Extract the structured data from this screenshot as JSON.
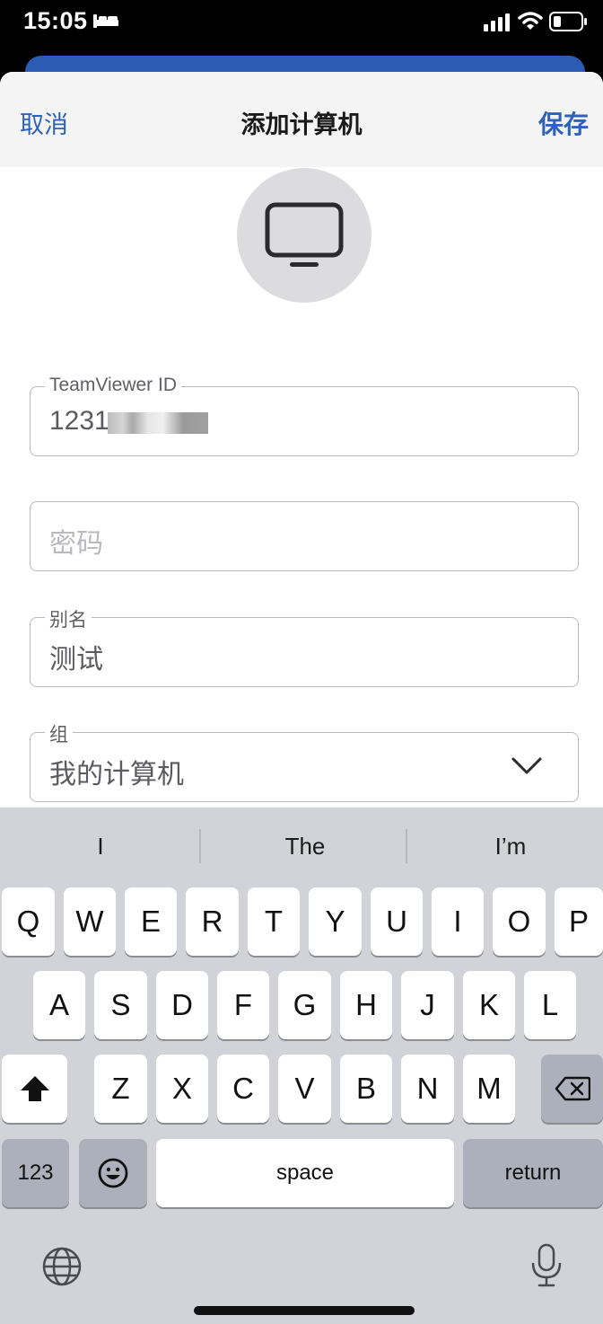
{
  "status_bar": {
    "time": "15:05"
  },
  "nav": {
    "cancel_label": "取消",
    "title": "添加计算机",
    "save_label": "保存"
  },
  "form": {
    "teamviewer_id": {
      "label": "TeamViewer ID",
      "value": "1231"
    },
    "password": {
      "placeholder": "密码"
    },
    "alias": {
      "label": "别名",
      "value": "测试"
    },
    "group": {
      "label": "组",
      "value": "我的计算机"
    }
  },
  "keyboard": {
    "suggestions": [
      "I",
      "The",
      "I’m"
    ],
    "row1": [
      "Q",
      "W",
      "E",
      "R",
      "T",
      "Y",
      "U",
      "I",
      "O",
      "P"
    ],
    "row2": [
      "A",
      "S",
      "D",
      "F",
      "G",
      "H",
      "J",
      "K",
      "L"
    ],
    "row3": [
      "Z",
      "X",
      "C",
      "V",
      "B",
      "N",
      "M"
    ],
    "numbers_label": "123",
    "space_label": "space",
    "return_label": "return"
  },
  "colors": {
    "accent": "#2e62b8",
    "keyboard_bg": "#d1d3d9"
  }
}
